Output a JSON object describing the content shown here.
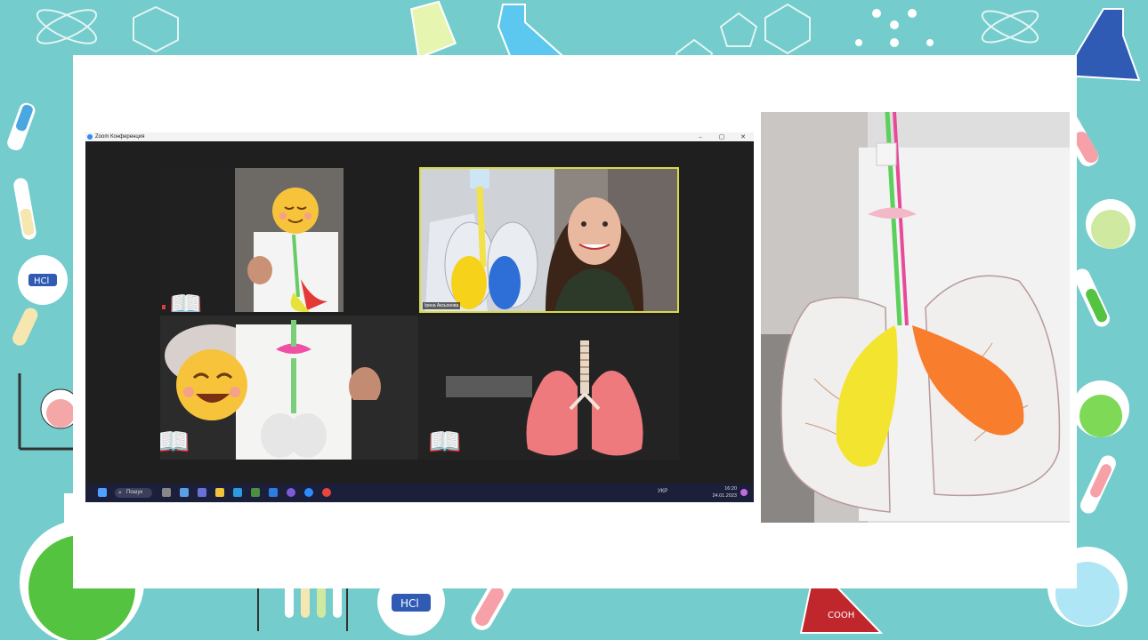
{
  "zoom": {
    "window_title": "Zoom Конференция",
    "controls": {
      "minimize": "–",
      "maximize": "▢",
      "close": "✕"
    },
    "participants": [
      {
        "name": ""
      },
      {
        "name": "Ірина Аксьонова"
      },
      {
        "name": ""
      },
      {
        "name": ""
      }
    ]
  },
  "taskbar": {
    "search_label": "Пошук",
    "language": "УКР",
    "time": "16:20",
    "date": "24.01.2023"
  },
  "icons": {
    "book": "📖"
  },
  "colors": {
    "border_teal": "#74cccc",
    "zoom_bg": "#242424",
    "active_speaker": "#d9d94a",
    "taskbar": "#1c1f3a"
  }
}
